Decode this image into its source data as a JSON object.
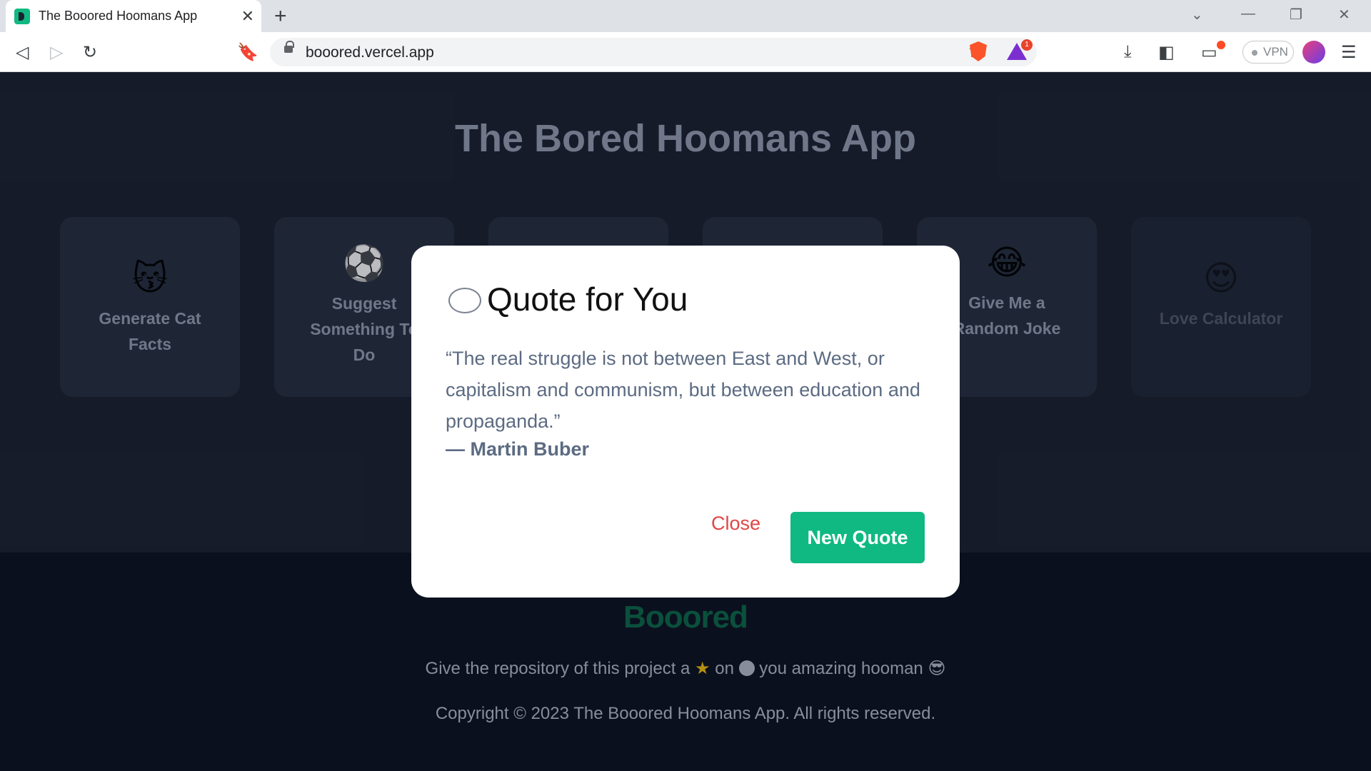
{
  "browser": {
    "tab_title": "The Booored Hoomans App",
    "url": "booored.vercel.app",
    "vpn_label": "VPN",
    "rewards_badge": "1"
  },
  "page": {
    "title": "The Bored Hoomans App",
    "cards": [
      {
        "emoji": "😽",
        "label": "Generate Cat Facts"
      },
      {
        "emoji": "⚽",
        "label": "Suggest Something To Do"
      },
      {
        "emoji": "",
        "label": ""
      },
      {
        "emoji": "",
        "label": ""
      },
      {
        "emoji": "😂",
        "label": "Give Me a Random Joke"
      },
      {
        "emoji": "😍",
        "label": "Love Calculator"
      }
    ]
  },
  "footer": {
    "logo": "Booored",
    "repo_text_1": "Give the repository of this project a",
    "repo_text_2": "on",
    "repo_text_3": "you amazing hooman",
    "copyright": "Copyright © 2023 The Booored Hoomans App. All rights reserved."
  },
  "modal": {
    "title": "Quote for You",
    "quote": "“The real struggle is not between East and West, or capitalism and communism, but between education and propaganda.”",
    "author": "— Martin Buber",
    "close_label": "Close",
    "new_quote_label": "New Quote"
  },
  "colors": {
    "accent": "#10b981",
    "danger": "#e24545",
    "page_bg": "#1a2130",
    "card_bg": "#263042"
  }
}
